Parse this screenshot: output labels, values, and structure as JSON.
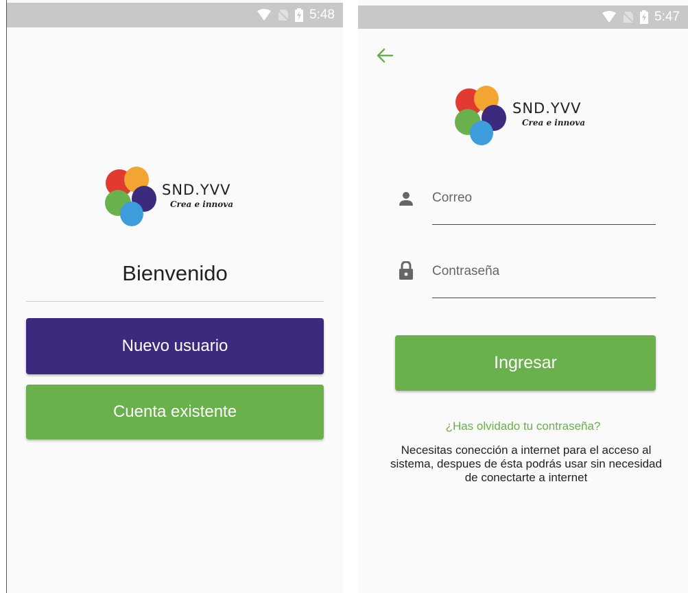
{
  "status_bar": {
    "left_time": "5:48",
    "right_time": "5:47"
  },
  "brand": {
    "name": "SND.YVV",
    "tagline": "Crea e innova"
  },
  "welcome_screen": {
    "title": "Bienvenido",
    "new_user_button": "Nuevo usuario",
    "existing_account_button": "Cuenta existente"
  },
  "login_screen": {
    "email_placeholder": "Correo",
    "password_placeholder": "Contraseña",
    "login_button": "Ingresar",
    "forgot_password_link": "¿Has olvidado tu contraseña?",
    "connection_note": "Necesitas conección a internet para el acceso al sistema, despues de ésta podrás usar sin necesidad de conectarte a internet"
  },
  "colors": {
    "purple": "#3b2a7e",
    "green": "#6ab04c",
    "status_bar": "#c8c8c8"
  },
  "icons": [
    "wifi-icon",
    "no-sim-icon",
    "battery-charging-icon",
    "back-arrow-icon",
    "person-icon",
    "lock-icon"
  ]
}
